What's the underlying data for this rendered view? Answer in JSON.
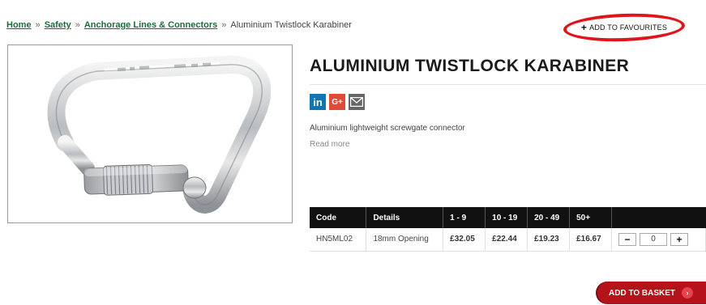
{
  "breadcrumb": {
    "home": "Home",
    "sep": "»",
    "safety": "Safety",
    "category": "Anchorage Lines & Connectors",
    "current": "Aluminium Twistlock Karabiner"
  },
  "favourites": {
    "plus": "+",
    "label": "ADD TO FAVOURITES"
  },
  "product": {
    "title": "ALUMINIUM TWISTLOCK KARABINER",
    "description": "Aluminium lightweight screwgate connector",
    "read_more": "Read more"
  },
  "social": {
    "linkedin": "in",
    "gplus": "G+",
    "email_icon": "envelope-icon"
  },
  "table": {
    "headers": [
      "Code",
      "Details",
      "1 - 9",
      "10 - 19",
      "20 - 49",
      "50+",
      ""
    ],
    "rows": [
      {
        "code": "HN5ML02",
        "details": "18mm Opening",
        "p1": "£32.05",
        "p2": "£22.44",
        "p3": "£19.23",
        "p4": "£16.67",
        "qty": "0"
      }
    ],
    "minus": "−",
    "plus": "+"
  },
  "basket": {
    "label": "ADD TO BASKET",
    "arrow": "›"
  },
  "colors": {
    "brand_red": "#b5121b",
    "link_green": "#1e6b3a",
    "highlight_red": "#e0141b"
  }
}
